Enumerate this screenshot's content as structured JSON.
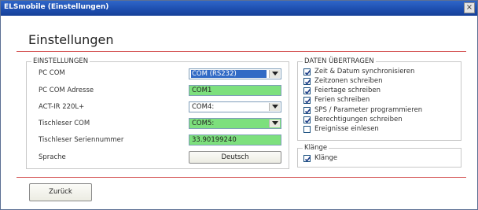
{
  "window": {
    "title": "ELSmobile (Einstellungen)",
    "close_glyph": "×"
  },
  "page": {
    "heading": "Einstellungen"
  },
  "settings": {
    "legend": "EINSTELLUNGEN",
    "pc_com": {
      "label": "PC COM",
      "value": "COM (RS232)"
    },
    "pc_com_adresse": {
      "label": "PC COM Adresse",
      "value": "COM1"
    },
    "act_ir": {
      "label": "ACT-IR 220L+",
      "value": "COM4:"
    },
    "tischleser_com": {
      "label": "Tischleser COM",
      "value": "COM5:"
    },
    "tischleser_sn": {
      "label": "Tischleser Seriennummer",
      "value": "33.90199240"
    },
    "sprache": {
      "label": "Sprache",
      "button": "Deutsch"
    }
  },
  "daten": {
    "legend": "DATEN ÜBERTRAGEN",
    "items": [
      {
        "label": "Zeit & Datum synchronisieren",
        "checked": true
      },
      {
        "label": "Zeitzonen schreiben",
        "checked": true
      },
      {
        "label": "Feiertage schreiben",
        "checked": true
      },
      {
        "label": "Ferien schreiben",
        "checked": true
      },
      {
        "label": "SPS / Parameter programmieren",
        "checked": true
      },
      {
        "label": "Berechtigungen schreiben",
        "checked": true
      },
      {
        "label": "Ereignisse einlesen",
        "checked": false
      }
    ]
  },
  "klaenge": {
    "legend": "Klänge",
    "item": {
      "label": "Klänge",
      "checked": true
    }
  },
  "footer": {
    "back_button": "Zurück"
  },
  "colors": {
    "titlebar": "#1e4fb0",
    "field_green": "#7de07d",
    "selection_blue": "#316ac5",
    "divider_red": "#d65a5a"
  }
}
